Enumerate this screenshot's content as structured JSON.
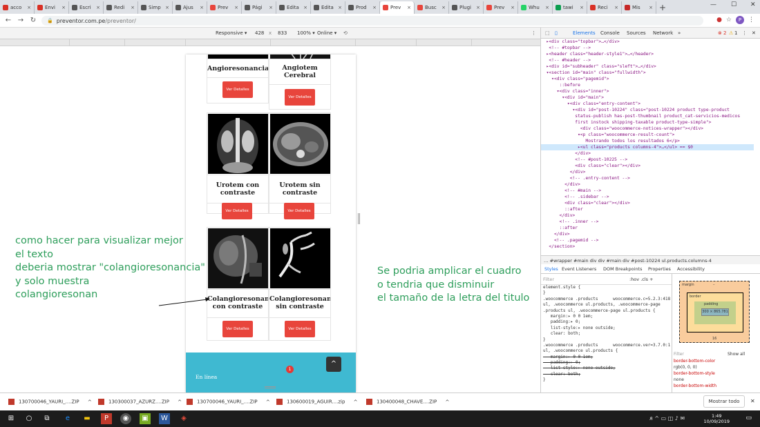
{
  "browser": {
    "tabs": [
      {
        "label": "acco",
        "color": "#d93025"
      },
      {
        "label": "Envi",
        "color": "#d93025"
      },
      {
        "label": "Escri",
        "color": "#555555"
      },
      {
        "label": "Redi",
        "color": "#555555"
      },
      {
        "label": "Simp",
        "color": "#555555"
      },
      {
        "label": "Ajus",
        "color": "#555555"
      },
      {
        "label": "Prev",
        "color": "#e8453c"
      },
      {
        "label": "Pági",
        "color": "#555555"
      },
      {
        "label": "Edita",
        "color": "#555555"
      },
      {
        "label": "Edita",
        "color": "#555555"
      },
      {
        "label": "Prod",
        "color": "#555555"
      },
      {
        "label": "Prev",
        "color": "#e8453c",
        "active": true
      },
      {
        "label": "Busc",
        "color": "#e8453c"
      },
      {
        "label": "Plugi",
        "color": "#555555"
      },
      {
        "label": "Prev",
        "color": "#e8453c"
      },
      {
        "label": "Whu",
        "color": "#25d366"
      },
      {
        "label": "tawi",
        "color": "#0b9e4f"
      },
      {
        "label": "Reci",
        "color": "#d93025"
      },
      {
        "label": "Mis",
        "color": "#c62828"
      }
    ],
    "url_host": "preventor.com.pe",
    "url_path": "/preventor/",
    "avatar_letter": "P"
  },
  "device_toolbar": {
    "device": "Responsive ▾",
    "width": "428",
    "x": "x",
    "height": "833",
    "zoom": "100% ▾",
    "network": "Online ▾"
  },
  "products": [
    {
      "name": "Angioresonancia",
      "button": "Ver Detalles"
    },
    {
      "name": "Angiotem Cerebral",
      "button": "Ver Detalles"
    },
    {
      "name": "Urotem con contraste",
      "button": "Ver Detalles"
    },
    {
      "name": "Urotem sin contraste",
      "button": "Ver Detalles"
    },
    {
      "name": "Colangioresonancia con contraste",
      "display_line1": "Colangioresonan",
      "display_line2": "con contraste",
      "button": "Ver Detalles"
    },
    {
      "name": "Colangioresonancia sin contraste",
      "display_line1": "Colangioresonan",
      "display_line2": "sin contraste",
      "button": "Ver Detalles"
    }
  ],
  "footer": {
    "online": "En línea",
    "badge": "1",
    "up": "^"
  },
  "annotations": {
    "left": "como hacer para visualizar mejor\nel texto\ndeberia mostrar \"colangioresonancia\"\ny solo muestra\ncolangioresonan",
    "right": "Se podria amplicar el cuadro\no tendria que disminuir\nel tamaño de la letra del titulo"
  },
  "devtools": {
    "tabs": [
      "Elements",
      "Console",
      "Sources",
      "Network",
      "»"
    ],
    "errors": "2",
    "warnings": "1",
    "elements": [
      "  ▸<div class=\"topbar\">…</div>",
      "   <!-- #topbar -->",
      "  ▸<header class=\"header-style1\">…</header>",
      "   <!-- #header -->",
      "  ▸<div id=\"subheader\" class=\"sleft\">…</div>",
      "  ▾<section id=\"main\" class=\"fullwidth\">",
      "    ▾<div class=\"pagemid\">",
      "       ::before",
      "      ▾<div class=\"inner\">",
      "        ▾<div id=\"main\">",
      "          ▾<div class=\"entry-content\">",
      "            ▾<div id=\"post-10224\" class=\"post-10224 product type-product",
      "             status-publish has-post-thumbnail product_cat-servicios-medicos",
      "             first instock shipping-taxable product-type-simple\">",
      "               <div class=\"woocommerce-notices-wrapper\"></div>",
      "              ▾<p class=\"woocommerce-result-count\">",
      "                 Mostrando todos los resultados 6</p>",
      "              ▸<ul class=\"products columns-4\">…</ul> == $0",
      "             </div>",
      "             <!-- #post-10225 -->",
      "             <div class=\"clear\"></div>",
      "           </div>",
      "           <!-- .entry-content -->",
      "         </div>",
      "         <!-- #main -->",
      "         <!-- .sidebar -->",
      "         <div class=\"clear\"></div>",
      "         ::after",
      "       </div>",
      "       <!-- .inner -->",
      "       ::after",
      "     </div>",
      "     <!-- .pagemid -->",
      "   </section>"
    ],
    "selected_line": 17,
    "breadcrumbs": "…  #wrapper  #main  div  div  #main  div  #post-10224  ul.products.columns-4",
    "subtabs": [
      "Styles",
      "Event Listeners",
      "DOM Breakpoints",
      "Properties",
      "Accessibility"
    ],
    "filter": "Filter",
    "hov": ":hov  .cls  +",
    "styles": [
      "element.style {",
      "}",
      ".woocommerce .products      woocommerce.c=5.2.3:418",
      "ul, .woocommerce ul.products, .woocommerce-page",
      ".products ul, .woocommerce-page ul.products {",
      "   margin:▸ 0 0 1em;",
      "   padding:▸ 0;",
      "   list-style:▸ none outside;",
      "   clear: both;",
      "}",
      ".woocommerce .products      woocommerce.ver=3.7.0:1",
      "ul, .woocommerce ul.products {",
      "   margin:▸ 0 0 1em;",
      "   padding:▸ 0;",
      "   list-style:▸ none outside;",
      "   clear: both;",
      "}"
    ],
    "boxmodel": {
      "margin": "margin",
      "border": "border",
      "padding": "padding",
      "content": "300 × 865.781",
      "dash": "–",
      "bottom": "16"
    },
    "computed_filter": "Filter",
    "show_all": "Show all",
    "computed": [
      "border-bottom-color",
      "rgb(0, 0, 0)",
      "border-bottom-style",
      "none",
      "border-bottom-width"
    ]
  },
  "downloads": [
    {
      "label": "130700046_YAURI_....ZIP"
    },
    {
      "label": "130300037_AZURZ....ZIP"
    },
    {
      "label": "130700046_YAURI_....ZIP"
    },
    {
      "label": "130600019_AGUIR....zip"
    },
    {
      "label": "130400048_CHAVE....ZIP"
    }
  ],
  "show_all_label": "Mostrar todo",
  "taskbar": {
    "time": "1:49",
    "date": "10/09/2019"
  }
}
